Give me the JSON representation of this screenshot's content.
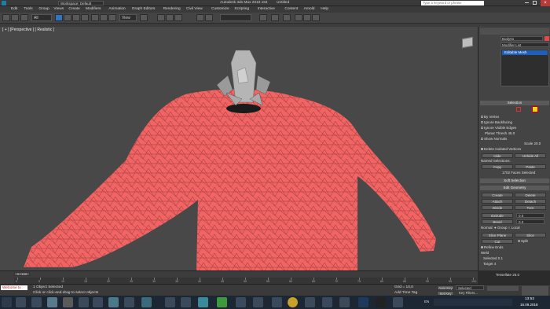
{
  "titlebar": {
    "workspace_label": "Workspace: Default",
    "title": "Autodesk 3ds Max 2018 x64",
    "file": "Untitled",
    "search_placeholder": "Type a keyword or phrase"
  },
  "menu": [
    "Edit",
    "Tools",
    "Group",
    "Views",
    "Create",
    "Modifiers",
    "Animation",
    "Graph Editors",
    "Rendering",
    "Civil View",
    "Customize",
    "Scripting",
    "Interactive",
    "Content",
    "Arnold",
    "Help"
  ],
  "toolbar": {
    "selection_filter": "All",
    "view_dropdown": "View"
  },
  "viewport": {
    "label": "[ + ] [Perspective ] [ Realistic ]"
  },
  "command_panel": {
    "object_name": "Body01",
    "modifier_list": "Modifier List",
    "stack_item": "Editable Mesh",
    "selection_header": "Selection",
    "by_vertex": "By Vertex",
    "ignore_backfacing": "Ignore Backfacing",
    "ignore_visible_edges": "Ignore Visible Edges",
    "planar_thresh": "Planar Thresh",
    "planar_val": "45.0",
    "show_normals": "Show Normals",
    "scale_label": "Scale",
    "scale_val": "20.0",
    "delete_isolated": "Delete Isolated Vertices",
    "hide": "Hide",
    "unhide_all": "Unhide All",
    "named_selections": "Named Selections:",
    "copy": "Copy",
    "paste": "Paste",
    "faces_selected": "1702 Faces Selected",
    "soft_selection": "Soft Selection",
    "edit_geometry": "Edit Geometry",
    "create": "Create",
    "delete": "Delete",
    "attach": "Attach",
    "detach": "Detach",
    "divide": "Divide",
    "turn": "Turn",
    "extrude": "Extrude",
    "extrude_val": "0.0",
    "bevel": "Bevel",
    "bevel_val": "0.0",
    "normal": "Normal:",
    "group": "Group",
    "local": "Local",
    "slice_plane": "Slice Plane",
    "slice": "Slice",
    "cut": "Cut",
    "split": "Split",
    "refine_ends": "Refine Ends",
    "weld": "Weld",
    "selected": "Selected",
    "selected_val": "0.1",
    "target": "Target",
    "target_val": "4",
    "tessellate": "Tessellate",
    "tess_val": "25.0"
  },
  "timeline": {
    "frame": "0 / 100",
    "ticks": [
      "0",
      "5",
      "10",
      "15",
      "20",
      "25",
      "30",
      "35",
      "40",
      "45",
      "50",
      "55",
      "60",
      "65",
      "70",
      "75",
      "80",
      "85",
      "90",
      "95",
      "100"
    ]
  },
  "status": {
    "maxscript": "Welcome to",
    "objects": "1 Object Selected",
    "prompt": "Click or click-and-drag to select objects",
    "grid": "Grid = 10,0",
    "auto_key": "Auto Key",
    "selected_dropdown": "Selected",
    "set_key": "Set Key",
    "key_filters": "Key Filters...",
    "add_time_tag": "Add Time Tag"
  },
  "taskbar": {
    "lang": "EN",
    "time": "13:52",
    "date": "16.09.2018"
  },
  "colors": {
    "mesh": "#f06464",
    "wire": "#7a2a2a",
    "accent_blue": "#1f5fb5"
  }
}
